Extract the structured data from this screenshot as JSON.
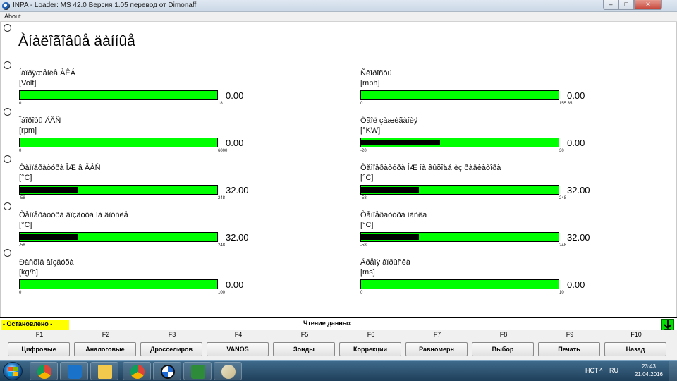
{
  "window": {
    "title": "INPA - Loader:  MS 42.0 Версия 1.05 перевод от Dimonaff",
    "menu": "About..."
  },
  "page": {
    "title": "Àíàëîãîâûå äàííûå"
  },
  "gauges": [
    {
      "label": "Íàïðÿæåíèå ÀÊÁ",
      "unit": "[Volt]",
      "min": "0",
      "max": "18",
      "value": "0.00",
      "fill": 0.0
    },
    {
      "label": "Ñêîðîñòü",
      "unit": "[mph]",
      "min": "0",
      "max": "155.35",
      "value": "0.00",
      "fill": 0.0
    },
    {
      "label": "Îáîðîòû ÄÂÑ",
      "unit": "[rpm]",
      "min": "0",
      "max": "6000",
      "value": "0.00",
      "fill": 0.0
    },
    {
      "label": "Óãîë çàæèãàíèÿ",
      "unit": "[°KW]",
      "min": "-20",
      "max": "30",
      "value": "0.00",
      "fill": 0.4
    },
    {
      "label": "Òåìïåðàòóðà ÎÆ â ÄÂÑ",
      "unit": "[°C]",
      "min": "-58",
      "max": "248",
      "value": "32.00",
      "fill": 0.2941
    },
    {
      "label": "Òåìïåðàòóðà ÎÆ íà âûõîäå èç ðàäèàòîðà",
      "unit": "[°C]",
      "min": "-58",
      "max": "248",
      "value": "32.00",
      "fill": 0.2941
    },
    {
      "label": "Òåìïåðàòóðà âîçäóõà íà âïóñêå",
      "unit": "[°C]",
      "min": "-58",
      "max": "248",
      "value": "32.00",
      "fill": 0.2941
    },
    {
      "label": "Òåìïåðàòóðà ìàñëà",
      "unit": "[°C]",
      "min": "-58",
      "max": "248",
      "value": "32.00",
      "fill": 0.2941
    },
    {
      "label": "Ðàñõîä âîçäóõà",
      "unit": "[kg/h]",
      "min": "0",
      "max": "100",
      "value": "0.00",
      "fill": 0.0
    },
    {
      "label": "Âðåìÿ âïðûñêà",
      "unit": "[ms]",
      "min": "0",
      "max": "10",
      "value": "0.00",
      "fill": 0.0
    }
  ],
  "status": {
    "left": "- Остановлено -",
    "center": "Чтение данных",
    "arrow_icon": "down-arrow-icon"
  },
  "fkeys": [
    {
      "key": "F1",
      "label": "Цифровые"
    },
    {
      "key": "F2",
      "label": "Аналоговые"
    },
    {
      "key": "F3",
      "label": "Дросселиров"
    },
    {
      "key": "F4",
      "label": "VANOS"
    },
    {
      "key": "F5",
      "label": "Зонды"
    },
    {
      "key": "F6",
      "label": "Коррекции"
    },
    {
      "key": "F7",
      "label": "Равномерн"
    },
    {
      "key": "F8",
      "label": "Выбор"
    },
    {
      "key": "F9",
      "label": "Печать"
    },
    {
      "key": "F10",
      "label": "Назад"
    }
  ],
  "taskbar": {
    "tray_lang": "НСТ",
    "tray_locale": "RU",
    "time": "23:43",
    "date": "21.04.2016"
  },
  "colors": {
    "bar": "#00ff00",
    "fill": "#000000",
    "status_left": "#ffff00",
    "status_arrow": "#00e000"
  }
}
